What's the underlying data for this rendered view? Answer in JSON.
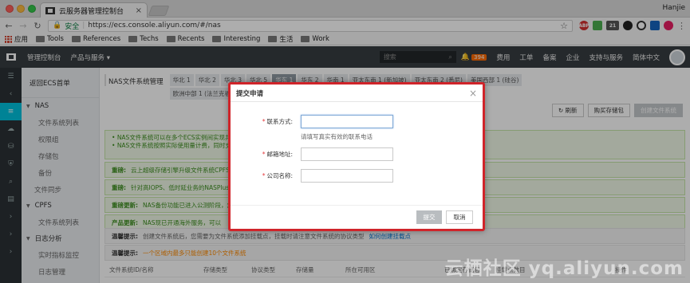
{
  "browser": {
    "tab_title": "云服务器管理控制台",
    "profile_name": "Hanjie",
    "secure_label": "安全",
    "url": "https://ecs.console.aliyun.com/#/nas",
    "bookmarks": [
      "应用",
      "Tools",
      "References",
      "Techs",
      "Recents",
      "Interesting",
      "生活",
      "Work"
    ],
    "extension_badge": "21"
  },
  "topbar": {
    "console_label": "管理控制台",
    "products_label": "产品与服务",
    "search_placeholder": "搜索",
    "bell_count": "394",
    "nav_items": [
      "费用",
      "工单",
      "备案",
      "企业",
      "支持与服务",
      "简体中文"
    ]
  },
  "sidebar": {
    "back_label": "返回ECS首单",
    "groups": [
      {
        "label": "NAS",
        "items": [
          "文件系统列表",
          "权限组",
          "存储包",
          "备份",
          "文件同步"
        ]
      },
      {
        "label": "CPFS",
        "items": [
          "文件系统列表"
        ]
      },
      {
        "label": "日志分析",
        "items": [
          "实时指标监控",
          "日志管理"
        ]
      }
    ]
  },
  "main": {
    "page_title": "NAS文件系统管理",
    "regions": [
      "华北 1",
      "华北 2",
      "华北 3",
      "华北 5",
      "华东 1",
      "华东 2",
      "华南 1",
      "亚太东南 1 (新加坡)",
      "亚太东南 2 (悉尼)",
      "美国西部 1 (硅谷)",
      "欧洲中部 1 (法兰克福)",
      "亚太东南 3 (吉隆坡)",
      "亚太东北 1"
    ],
    "active_region_index": 4,
    "refresh_label": "刷新",
    "buy_pack_label": "购买存储包",
    "create_label": "创建文件系统",
    "notice_lines": [
      "NAS文件系统可以在多个ECS实例间实现共享访问",
      "NAS文件系统按照实际使用量计费，同时支持存储包"
    ],
    "notices": [
      {
        "key": "重磅:",
        "text": "云上超级存储引擎升级文件系统CPFS"
      },
      {
        "key": "重磅:",
        "text": "针对高IOPS、低时延业务的NASPlus"
      },
      {
        "key": "重磅更新:",
        "text": "NAS备份功能已进入公测阶段，您可以"
      },
      {
        "key": "产品更新:",
        "text": "NAS现已开通海外服务，可以"
      }
    ],
    "tips": [
      {
        "key": "温馨提示:",
        "text": "创建文件系统后，您需要为文件系统添加挂载点，挂载时请注意文件系统的协议类型",
        "link": "如何创建挂载点"
      },
      {
        "key": "温馨提示:",
        "text": "一个区域内最多只能创建10个文件系统"
      }
    ],
    "columns": [
      "文件系统ID/名称",
      "存储类型",
      "协议类型",
      "存储量",
      "所在可用区",
      "已绑定存储包",
      "挂载点数目",
      "操作"
    ]
  },
  "dialog": {
    "title": "提交申请",
    "fields": [
      {
        "label": "联系方式:",
        "value": "",
        "hint": "请填写真实有效的联系电话"
      },
      {
        "label": "邮箱地址:",
        "value": ""
      },
      {
        "label": "公司名称:",
        "value": ""
      }
    ],
    "submit_label": "提交",
    "cancel_label": "取消"
  },
  "watermark": "云栖社区 yq.aliyun.com"
}
